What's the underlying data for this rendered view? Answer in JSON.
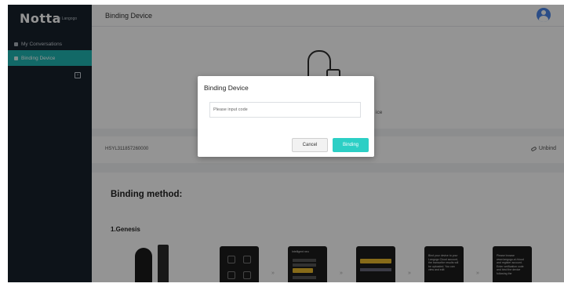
{
  "sidebar": {
    "logo": "Notta",
    "logo_sub": "by Langogo",
    "items": [
      {
        "label": "My Conversations",
        "icon": "conversations-icon"
      },
      {
        "label": "Binding Device",
        "icon": "device-icon",
        "active": true
      }
    ],
    "collapse_icon": "collapse-sidebar-icon"
  },
  "header": {
    "title": "Binding Device",
    "avatar_icon": "user-avatar-icon"
  },
  "device": {
    "status_text": "ice",
    "serial": "HSYL311857260000",
    "unbind_label": "Unbind"
  },
  "method": {
    "title": "Binding method:",
    "section_title": "1.Genesis",
    "steps": [
      {
        "line": "Intelligent neo"
      },
      {
        "line": "Bind your device to your Langogo Cloud account, the transcribe results will be uploaded. You can view and edit"
      },
      {
        "line": "Please browse www.langogo.ai /cloud and register account. Enter verification code and bind the device following the"
      }
    ]
  },
  "modal": {
    "title": "Binding Device",
    "input_placeholder": "Please input code",
    "input_value": "",
    "cancel_label": "Cancel",
    "confirm_label": "Binding"
  },
  "colors": {
    "sidebar_bg": "#17212b",
    "accent": "#1fb6b1",
    "button_primary": "#2ccfc5"
  }
}
